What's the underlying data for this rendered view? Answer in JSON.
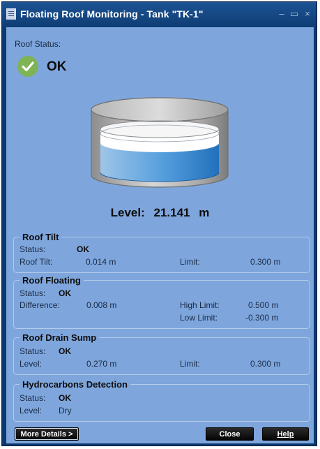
{
  "window": {
    "title": "Floating Roof Monitoring - Tank \"TK-1\"",
    "minimize_glyph": "–",
    "maximize_glyph": "▭",
    "close_glyph": "×"
  },
  "roof_status": {
    "label": "Roof Status:",
    "value": "OK",
    "icon": "check-circle-icon",
    "color": "#7eb356"
  },
  "level": {
    "label": "Level:",
    "value": "21.141",
    "unit": "m"
  },
  "groups": {
    "roof_tilt": {
      "title": "Roof Tilt",
      "status_label": "Status:",
      "status_value": "OK",
      "tilt_label": "Roof Tilt:",
      "tilt_value": "0.014 m",
      "limit_label": "Limit:",
      "limit_value": "0.300 m"
    },
    "roof_floating": {
      "title": "Roof Floating",
      "status_label": "Status:",
      "status_value": "OK",
      "diff_label": "Difference:",
      "diff_value": "0.008 m",
      "high_limit_label": "High Limit:",
      "high_limit_value": "0.500 m",
      "low_limit_label": "Low Limit:",
      "low_limit_value": "-0.300 m"
    },
    "roof_drain_sump": {
      "title": "Roof Drain Sump",
      "status_label": "Status:",
      "status_value": "OK",
      "level_label": "Level:",
      "level_value": "0.270 m",
      "limit_label": "Limit:",
      "limit_value": "0.300 m"
    },
    "hydrocarbons": {
      "title": "Hydrocarbons Detection",
      "status_label": "Status:",
      "status_value": "OK",
      "level_label": "Level:",
      "level_value": "Dry"
    }
  },
  "buttons": {
    "more_details": "More Details >",
    "close": "Close",
    "help": "Help"
  },
  "colors": {
    "titlebar": "#0f3d74",
    "client_bg": "#7ea6dc",
    "ok_green": "#7eb356",
    "liquid": "#3d8fd6"
  }
}
